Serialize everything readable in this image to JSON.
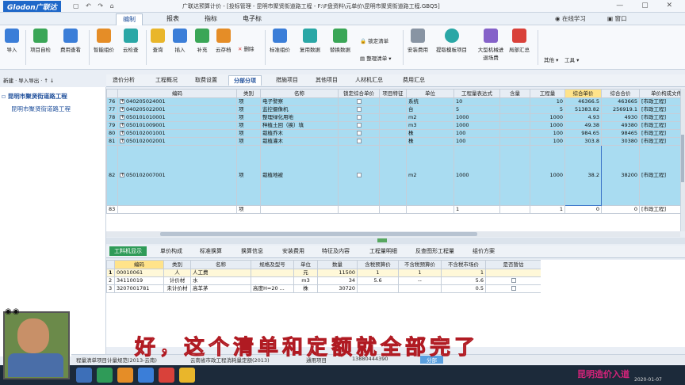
{
  "app": {
    "logo": "Glodon广联达",
    "title": "广联达预算计价 - [投标管理 - 昆明市聚贤街道路工程 - F:\\F盘资料\\元单价\\昆明市聚贤街道路工程.GBQ5]",
    "window_controls": "— ▢ ✕"
  },
  "menu": {
    "tabs": [
      "编制",
      "报表",
      "指标",
      "电子标"
    ],
    "online_learning": "在线学习",
    "window": "窗口"
  },
  "ribbon": {
    "buttons": [
      "导入",
      "项目自检",
      "费用查看",
      "智能组价",
      "云检查",
      "查询",
      "插入",
      "补充",
      "云存档",
      "删除",
      "标准组价",
      "复用数据",
      "替换数据",
      "锁定清单",
      "整理清单",
      "安装费用",
      "提取模板项目",
      "大型机械进退场费",
      "局部汇总",
      "其他",
      "工具"
    ]
  },
  "left_panel": {
    "toolbar": "新建 · 导入导出 · ↑ ↓",
    "tree": [
      "昆明市聚贤街道路工程",
      "昆明市聚贤街道路工程"
    ]
  },
  "subtabs": [
    "造价分析",
    "工程概况",
    "取费设置",
    "分部分项",
    "措施项目",
    "其他项目",
    "人材机汇总",
    "费用汇总"
  ],
  "subtab_active": 3,
  "main_grid": {
    "columns": [
      "",
      "编码",
      "类别",
      "名称",
      "锁定综合单价",
      "项目特征",
      "单位",
      "工程量表达式",
      "含量",
      "工程量",
      "综合单价",
      "综合合价",
      "单价构成文件"
    ],
    "rows": [
      {
        "no": "76",
        "code": "040205024001",
        "type": "项",
        "name": "电子警察",
        "unit": "系统",
        "expr": "10",
        "qty": "10",
        "price": "46366.5",
        "total": "463665",
        "file": "[市政工程]"
      },
      {
        "no": "77",
        "code": "040205022001",
        "type": "项",
        "name": "监控摄像机",
        "unit": "台",
        "expr": "5",
        "qty": "5",
        "price": "51383.82",
        "total": "256919.1",
        "file": "[市政工程]"
      },
      {
        "no": "78",
        "code": "050101010001",
        "type": "项",
        "name": "整理绿化用地",
        "unit": "m2",
        "expr": "1000",
        "qty": "1000",
        "price": "4.93",
        "total": "4930",
        "file": "[市政工程]"
      },
      {
        "no": "79",
        "code": "050101009001",
        "type": "项",
        "name": "种植土回（换）填",
        "unit": "m3",
        "expr": "1000",
        "qty": "1000",
        "price": "49.38",
        "total": "49380",
        "file": "[市政工程]"
      },
      {
        "no": "80",
        "code": "050102001001",
        "type": "项",
        "name": "栽植乔木",
        "unit": "株",
        "expr": "100",
        "qty": "100",
        "price": "984.65",
        "total": "98465",
        "file": "[市政工程]"
      },
      {
        "no": "81",
        "code": "050102002001",
        "type": "项",
        "name": "栽植灌木",
        "unit": "株",
        "expr": "100",
        "qty": "100",
        "price": "303.8",
        "total": "30380",
        "file": "[市政工程]"
      },
      {
        "no": "82",
        "code": "050102007001",
        "type": "项",
        "name": "栽植地被",
        "unit": "m2",
        "expr": "1000",
        "qty": "1000",
        "price": "38.2",
        "total": "38200",
        "file": "[市政工程]"
      },
      {
        "no": "83",
        "code": "",
        "type": "项",
        "name": "",
        "unit": "",
        "expr": "1",
        "qty": "1",
        "price": "0",
        "total": "0",
        "file": "[市政工程]"
      }
    ]
  },
  "bottom_tabs": [
    "工料机显示",
    "单价构成",
    "标准换算",
    "换算信息",
    "安装费用",
    "特征及内容",
    "工程量明细",
    "反查图形工程量",
    "组价方案"
  ],
  "bottom_grid": {
    "columns": [
      "",
      "编码",
      "类别",
      "名称",
      "规格及型号",
      "单位",
      "数量",
      "含税预算价",
      "不含税预算价",
      "不含税市场价",
      "是否暂估"
    ],
    "rows": [
      {
        "no": "1",
        "code": "00010061",
        "type": "人",
        "name": "人工费",
        "spec": "",
        "unit": "元",
        "qty": "11500",
        "p1": "1",
        "p2": "1",
        "p3": "1"
      },
      {
        "no": "2",
        "code": "34110019",
        "type": "计价材",
        "name": "水",
        "spec": "",
        "unit": "m3",
        "qty": "34",
        "p1": "5.6",
        "p2": "--",
        "p3": "5.6"
      },
      {
        "no": "3",
        "code": "3207001781",
        "type": "未计价材",
        "name": "高羊茅",
        "spec": "高度H=20 ...",
        "unit": "株",
        "qty": "30720",
        "p1": "",
        "p2": "",
        "p3": "0.5"
      }
    ]
  },
  "status": {
    "s1": "程量清单项目计量规范(2013-云南)",
    "s2": "云南省市政工程消耗量定额(2013)",
    "s3": "通用项目",
    "s4": "13880444390",
    "s5": "分部"
  },
  "subtitle": "好，这个清单和定额就全部完了",
  "watermark": "昆明造价入道",
  "date_watermark": "2020-01-07",
  "colors": {
    "accent": "#1f68c9",
    "selected_row": "#a9dcf1",
    "header_highlight": "#ffe38a",
    "active_bottom_tab": "#2f9b58",
    "subtitle_stroke": "#b01a22"
  }
}
